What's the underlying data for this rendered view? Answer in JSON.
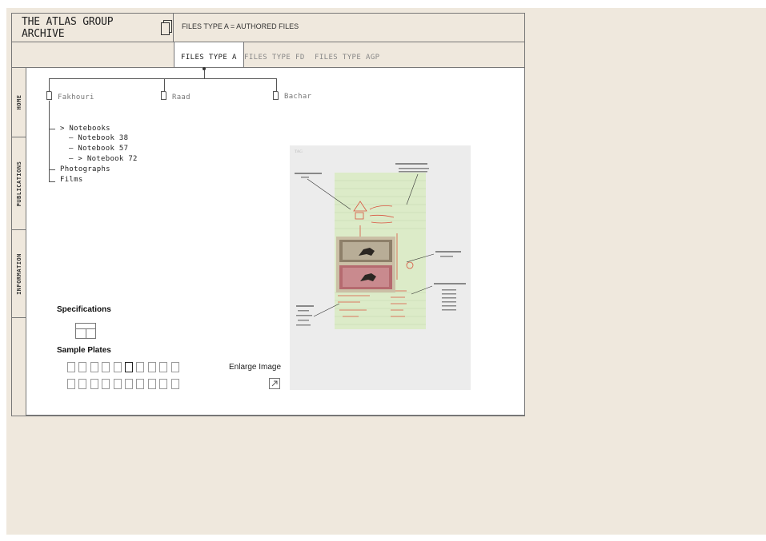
{
  "header": {
    "logo_text": "THE ATLAS GROUP ARCHIVE",
    "title": "FILES TYPE A = AUTHORED FILES"
  },
  "tabs": [
    {
      "label": "FILES TYPE A",
      "active": true
    },
    {
      "label": "FILES TYPE FD",
      "active": false
    },
    {
      "label": "FILES TYPE AGP",
      "active": false
    }
  ],
  "sidebar": {
    "items": [
      {
        "label": "HOME"
      },
      {
        "label": "PUBLICATIONS"
      },
      {
        "label": "INFORMATION"
      }
    ]
  },
  "tree": {
    "folders": [
      {
        "label": "Fakhouri"
      },
      {
        "label": "Raad"
      },
      {
        "label": "Bachar"
      }
    ],
    "items": [
      {
        "label": "> Notebooks"
      },
      {
        "label": "— Notebook 38"
      },
      {
        "label": "— Notebook 57"
      },
      {
        "label": "— > Notebook 72"
      },
      {
        "label": "Photographs"
      },
      {
        "label": "Films"
      }
    ]
  },
  "specifications": {
    "label": "Specifications"
  },
  "sample_plates": {
    "label": "Sample Plates",
    "row_counts": [
      10,
      10
    ],
    "active_index": 5
  },
  "enlarge": {
    "label": "Enlarge Image",
    "icon": "arrow-diagonal-icon"
  },
  "colors": {
    "background": "#efe8dd",
    "panel": "#ffffff",
    "border": "#777777",
    "annotation_red": "#d9533f",
    "notebook_green": "#dcebc8"
  }
}
